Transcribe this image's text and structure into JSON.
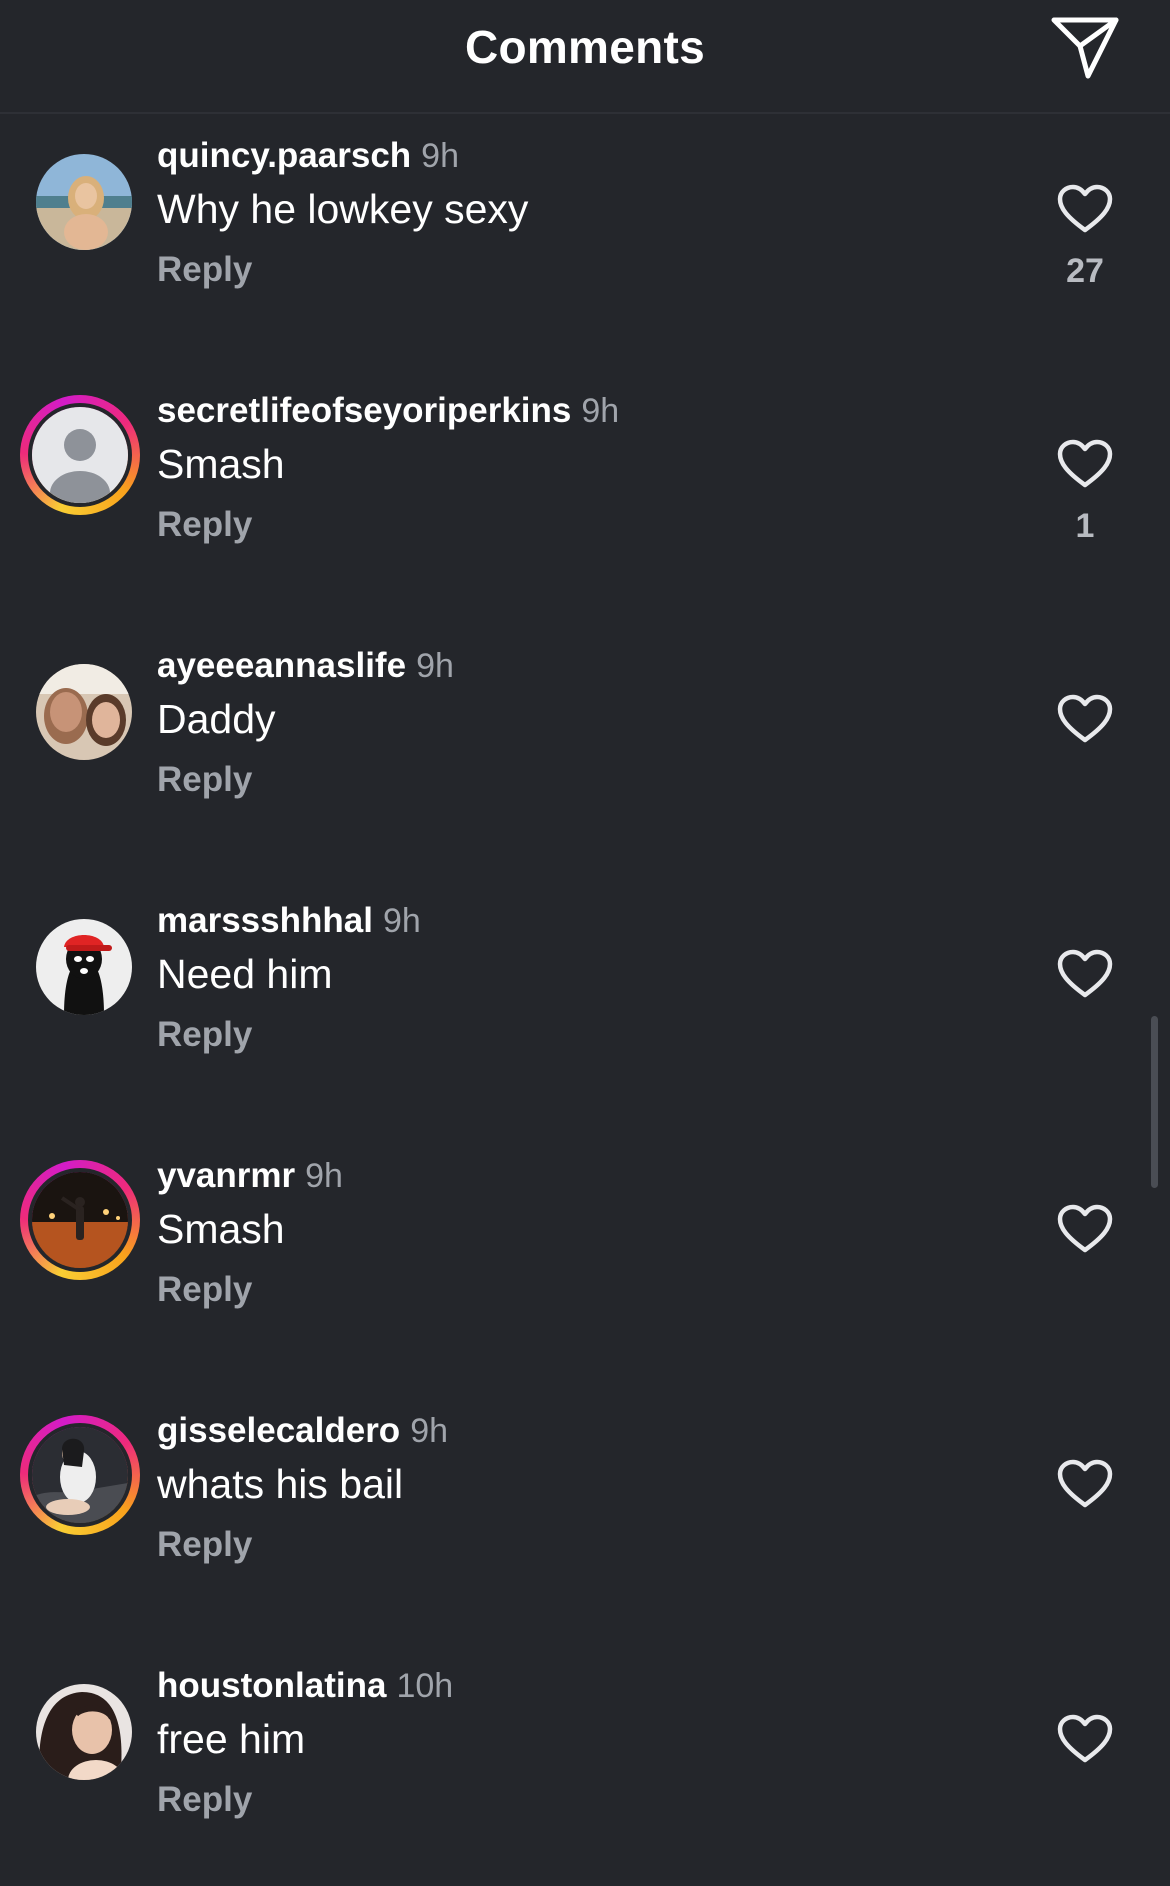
{
  "header": {
    "title": "Comments",
    "send_icon": "paper-plane-icon"
  },
  "colors": {
    "background": "#24262b",
    "ring_start": "#f9ce34",
    "ring_end": "#ee2a7b",
    "secondary_text": "#a0a4ab"
  },
  "comments": [
    {
      "username": "quincy.paarsch",
      "time": "9h",
      "text": "Why he lowkey sexy",
      "reply_label": "Reply",
      "likes": "27",
      "story_ring": false
    },
    {
      "username": "secretlifeofseyoriperkins",
      "time": "9h",
      "text": "Smash",
      "reply_label": "Reply",
      "likes": "1",
      "story_ring": true
    },
    {
      "username": "ayeeeannaslife",
      "time": "9h",
      "text": "Daddy",
      "reply_label": "Reply",
      "likes": "",
      "story_ring": false
    },
    {
      "username": "marssshhhal",
      "time": "9h",
      "text": "Need him",
      "reply_label": "Reply",
      "likes": "",
      "story_ring": false
    },
    {
      "username": "yvanrmr",
      "time": "9h",
      "text": "Smash",
      "reply_label": "Reply",
      "likes": "",
      "story_ring": true
    },
    {
      "username": "gisselecaldero",
      "time": "9h",
      "text": "whats his bail",
      "reply_label": "Reply",
      "likes": "",
      "story_ring": true
    },
    {
      "username": "houstonlatina",
      "time": "10h",
      "text": "free him",
      "reply_label": "Reply",
      "likes": "",
      "story_ring": false
    }
  ]
}
